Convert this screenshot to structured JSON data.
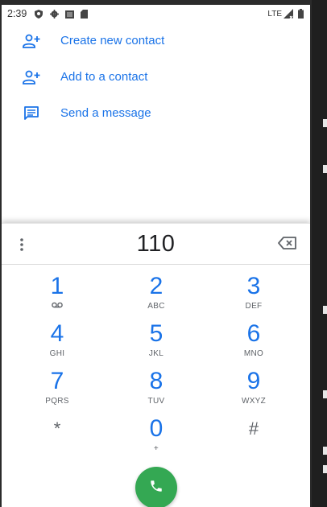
{
  "status_bar": {
    "time": "2:39",
    "network": "LTE",
    "icons": [
      "shield-icon",
      "gear-icon",
      "sim-card-icon",
      "sd-card-icon",
      "signal-icon",
      "battery-icon"
    ]
  },
  "actions": [
    {
      "label": "Create new contact",
      "icon": "person-add-icon"
    },
    {
      "label": "Add to a contact",
      "icon": "person-add-icon"
    },
    {
      "label": "Send a message",
      "icon": "message-icon"
    }
  ],
  "dialer": {
    "number": "110",
    "keys": [
      {
        "digit": "1",
        "letters": ""
      },
      {
        "digit": "2",
        "letters": "ABC"
      },
      {
        "digit": "3",
        "letters": "DEF"
      },
      {
        "digit": "4",
        "letters": "GHI"
      },
      {
        "digit": "5",
        "letters": "JKL"
      },
      {
        "digit": "6",
        "letters": "MNO"
      },
      {
        "digit": "7",
        "letters": "PQRS"
      },
      {
        "digit": "8",
        "letters": "TUV"
      },
      {
        "digit": "9",
        "letters": "WXYZ"
      },
      {
        "digit": "*",
        "letters": ""
      },
      {
        "digit": "0",
        "letters": "+"
      },
      {
        "digit": "#",
        "letters": ""
      }
    ]
  },
  "colors": {
    "accent": "#1a73e8",
    "call_button": "#34a853",
    "secondary_text": "#5f6368"
  }
}
